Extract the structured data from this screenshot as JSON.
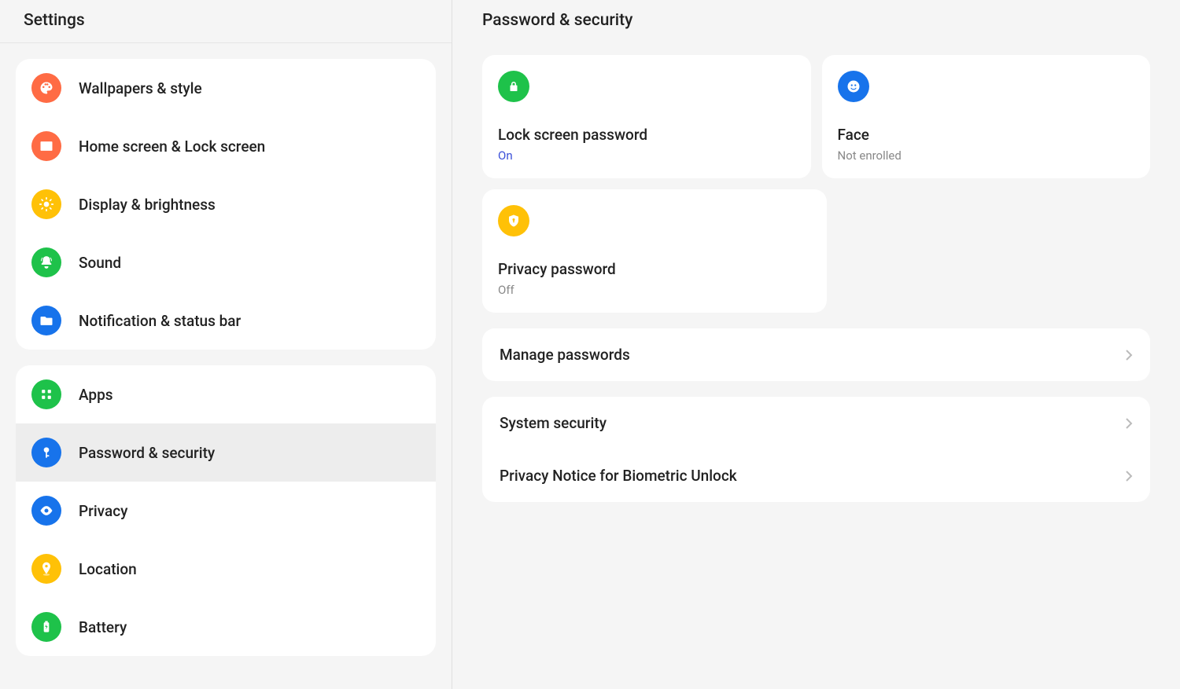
{
  "left": {
    "title": "Settings",
    "groups": [
      {
        "items": [
          {
            "id": "wallpapers",
            "label": "Wallpapers & style",
            "icon": "palette",
            "color": "#ff6b44"
          },
          {
            "id": "homescreen",
            "label": "Home screen & Lock screen",
            "icon": "image",
            "color": "#ff6b44"
          },
          {
            "id": "display",
            "label": "Display & brightness",
            "icon": "sun",
            "color": "#ffc107"
          },
          {
            "id": "sound",
            "label": "Sound",
            "icon": "bell",
            "color": "#1ec24a"
          },
          {
            "id": "notification",
            "label": "Notification & status bar",
            "icon": "folder",
            "color": "#1773eb"
          }
        ]
      },
      {
        "items": [
          {
            "id": "apps",
            "label": "Apps",
            "icon": "grid",
            "color": "#1ec24a"
          },
          {
            "id": "security",
            "label": "Password & security",
            "icon": "key",
            "color": "#1773eb",
            "selected": true
          },
          {
            "id": "privacy",
            "label": "Privacy",
            "icon": "eye",
            "color": "#1773eb"
          },
          {
            "id": "location",
            "label": "Location",
            "icon": "pin",
            "color": "#ffc107"
          },
          {
            "id": "battery",
            "label": "Battery",
            "icon": "battery",
            "color": "#1ec24a"
          }
        ]
      }
    ]
  },
  "right": {
    "title": "Password & security",
    "cards": [
      {
        "id": "lockscreen",
        "title": "Lock screen password",
        "status": "On",
        "statusClass": "status-on",
        "icon": "lock",
        "color": "#1ec24a"
      },
      {
        "id": "face",
        "title": "Face",
        "status": "Not enrolled",
        "statusClass": "status-off",
        "icon": "face",
        "color": "#1773eb"
      },
      {
        "id": "privacypw",
        "title": "Privacy password",
        "status": "Off",
        "statusClass": "status-off",
        "icon": "shield",
        "color": "#ffc107"
      }
    ],
    "list1": [
      {
        "id": "manage",
        "label": "Manage passwords"
      }
    ],
    "list2": [
      {
        "id": "systemsec",
        "label": "System security"
      },
      {
        "id": "privacynotice",
        "label": "Privacy Notice for Biometric Unlock"
      }
    ]
  }
}
